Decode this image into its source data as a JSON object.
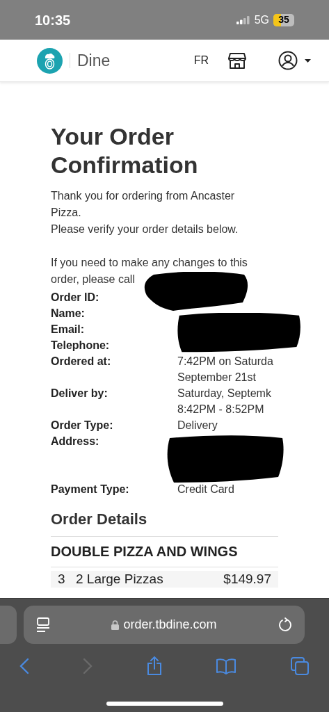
{
  "status_bar": {
    "time": "10:35",
    "network": "5G",
    "battery": "35"
  },
  "nav": {
    "brand": "Dine",
    "language": "FR"
  },
  "title": "Your Order Confirmation",
  "intro": [
    "Thank you for ordering from Ancaster Pizza.",
    "Please verify your order details below."
  ],
  "contact_note": {
    "text": "If you need to make any changes to this order, please call",
    "redacted": true
  },
  "details": [
    {
      "label": "Order ID:",
      "kind": "redacted"
    },
    {
      "label": "Name:",
      "kind": "redacted"
    },
    {
      "label": "Email:",
      "kind": "redacted"
    },
    {
      "label": "Telephone:",
      "kind": "redacted"
    },
    {
      "label": "Ordered at:",
      "kind": "text",
      "lines": [
        "7:42PM on Saturda",
        "September 21st"
      ]
    },
    {
      "label": "Deliver by:",
      "kind": "text",
      "lines": [
        "Saturday, Septemk",
        "8:42PM - 8:52PM"
      ]
    },
    {
      "label": "Order Type:",
      "kind": "text",
      "lines": [
        "Delivery"
      ]
    },
    {
      "label": "Address:",
      "kind": "redacted_block"
    },
    {
      "label": "Payment Type:",
      "kind": "text",
      "lines": [
        "Credit Card"
      ]
    }
  ],
  "order_details": {
    "heading": "Order Details",
    "section": "DOUBLE PIZZA AND WINGS",
    "items": [
      {
        "quantity": "3",
        "name": "2 Large Pizzas",
        "price": "$149.97"
      }
    ]
  },
  "browser": {
    "url": "order.tbdine.com"
  }
}
